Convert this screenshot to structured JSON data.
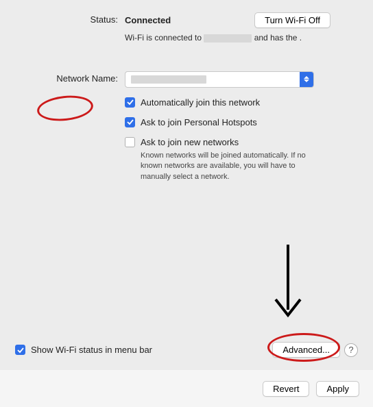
{
  "status": {
    "label": "Status:",
    "value": "Connected",
    "wifi_off_button": "Turn Wi-Fi Off",
    "desc_prefix": "Wi-Fi is connected to ",
    "desc_suffix": " and has the ."
  },
  "network": {
    "label": "Network Name:"
  },
  "checkboxes": {
    "auto_join": {
      "label": "Automatically join this network",
      "checked": true
    },
    "ask_hotspot": {
      "label": "Ask to join Personal Hotspots",
      "checked": true
    },
    "ask_new": {
      "label": "Ask to join new networks",
      "checked": false
    },
    "ask_new_desc": "Known networks will be joined automatically. If no known networks are available, you will have to manually select a network."
  },
  "bottom": {
    "show_status": {
      "label": "Show Wi-Fi status in menu bar",
      "checked": true
    },
    "advanced": "Advanced...",
    "help": "?"
  },
  "footer": {
    "revert": "Revert",
    "apply": "Apply"
  }
}
